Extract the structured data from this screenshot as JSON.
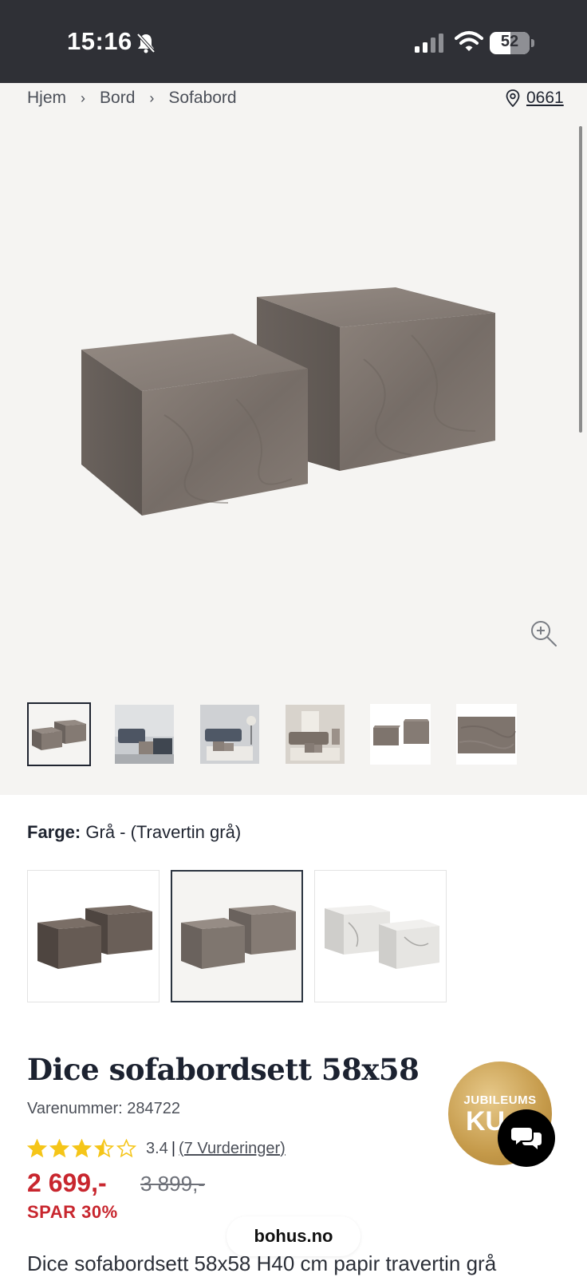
{
  "status_bar": {
    "time": "15:16",
    "battery": "52"
  },
  "breadcrumb": {
    "items": [
      "Hjem",
      "Bord",
      "Sofabord"
    ],
    "separator": "›"
  },
  "store": {
    "code": "0661"
  },
  "gallery": {
    "thumbnail_count": 6,
    "active_index": 0
  },
  "color": {
    "label": "Farge:",
    "value": "Grå - (Travertin grå)",
    "options": [
      {
        "name": "brown-wood",
        "color": "#6b5f56"
      },
      {
        "name": "grey-travertine",
        "color": "#8a8079",
        "selected": true
      },
      {
        "name": "white-marble",
        "color": "#e8e8e6"
      }
    ]
  },
  "product": {
    "title": "Dice sofabordsett 58x58",
    "sku": "Varenummer: 284722",
    "rating": "3.4",
    "rating_value": 3.4,
    "rating_max": 5,
    "rating_separator": "|",
    "reviews": "(7 Vurderinger)",
    "price": "2 699,-",
    "old_price": "3 899,-",
    "discount": "SPAR 30%",
    "description": "Dice sofabordsett 58x58 H40 cm papir travertin grå"
  },
  "badge": {
    "line1": "JUBILEUMS",
    "line2": "KU"
  },
  "footer": {
    "domain": "bohus.no"
  },
  "colors": {
    "price_red": "#c8262e",
    "star_yellow": "#f5c518",
    "dark": "#1f2430"
  }
}
